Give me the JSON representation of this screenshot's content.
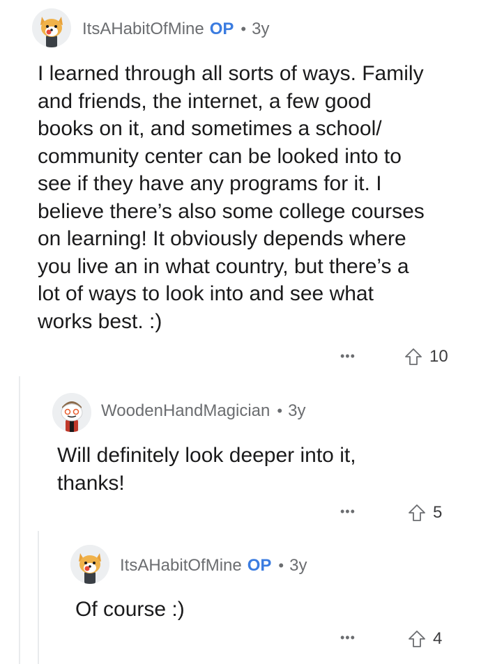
{
  "comments": [
    {
      "username": "ItsAHabitOfMine",
      "badge": "OP",
      "separator": "•",
      "age": "3y",
      "avatar_icon": "shiba-dog-avatar-icon",
      "lines": [
        "I learned through all sorts of ways. Family",
        "and friends, the internet, a few good",
        "books on it, and sometimes a school/",
        "community center can be looked into to",
        "see if they have any programs for it. I",
        "believe there’s also some college courses",
        "on learning! It obviously depends where",
        "you live an in what country, but there’s a",
        "lot of ways to look into and see what",
        "works best.  :)"
      ],
      "more_label": "•••",
      "upvotes": "10"
    },
    {
      "username": "WoodenHandMagician",
      "separator": "•",
      "age": "3y",
      "avatar_icon": "snoo-avatar-icon",
      "lines": [
        "Will definitely look deeper into it,",
        "thanks!"
      ],
      "more_label": "•••",
      "upvotes": "5"
    },
    {
      "username": "ItsAHabitOfMine",
      "badge": "OP",
      "separator": "•",
      "age": "3y",
      "avatar_icon": "shiba-dog-avatar-icon",
      "lines": [
        "Of course :)"
      ],
      "more_label": "•••",
      "upvotes": "4"
    }
  ],
  "colors": {
    "meta_gray": "#6b6d70",
    "op_blue": "#3b7ce0",
    "thread_line": "#e9ebed",
    "text": "#1a1a1b"
  }
}
